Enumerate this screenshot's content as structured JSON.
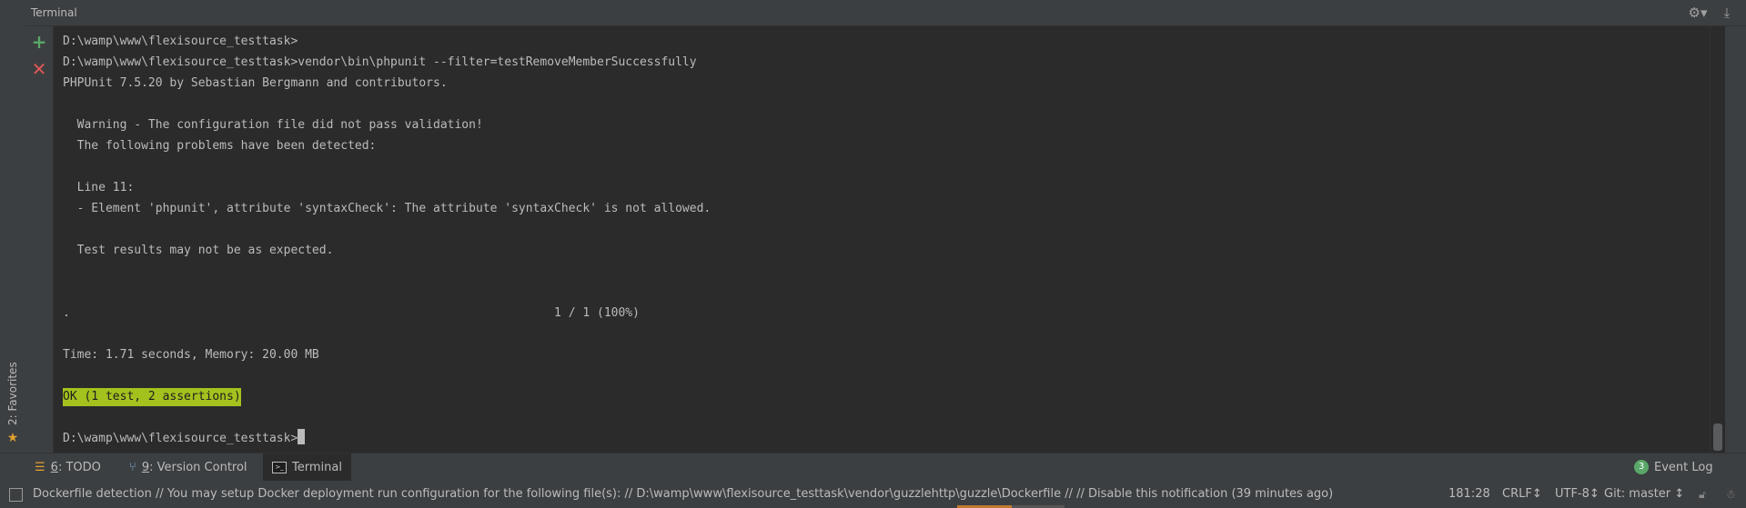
{
  "terminal": {
    "title": "Terminal",
    "lines": [
      "D:\\wamp\\www\\flexisource_testtask>",
      "D:\\wamp\\www\\flexisource_testtask>vendor\\bin\\phpunit --filter=testRemoveMemberSuccessfully",
      "PHPUnit 7.5.20 by Sebastian Bergmann and contributors.",
      "",
      "  Warning - The configuration file did not pass validation!",
      "  The following problems have been detected:",
      "",
      "  Line 11:",
      "  - Element 'phpunit', attribute 'syntaxCheck': The attribute 'syntaxCheck' is not allowed.",
      "",
      "  Test results may not be as expected.",
      "",
      "",
      ".                                                                    1 / 1 (100%)",
      "",
      "Time: 1.71 seconds, Memory: 20.00 MB",
      ""
    ],
    "ok_line": "OK (1 test, 2 assertions)",
    "prompt": "D:\\wamp\\www\\flexisource_testtask>"
  },
  "side_panel": {
    "add_icon": "plus-icon",
    "close_icon": "close-icon"
  },
  "favorites": {
    "label": "2: Favorites",
    "icon": "star-icon"
  },
  "tool_tabs": [
    {
      "mnemonic": "6",
      "label": ": TODO",
      "icon": "todo-icon"
    },
    {
      "mnemonic": "9",
      "label": ": Version Control",
      "icon": "branch-icon"
    },
    {
      "label": "Terminal",
      "icon": "terminal-icon"
    }
  ],
  "event_log": {
    "badge": "3",
    "label": "Event Log"
  },
  "status_bar": {
    "message": "Dockerfile detection  // You may setup Docker deployment run configuration for the following file(s): // D:\\wamp\\www\\flexisource_testtask\\vendor\\guzzlehttp\\guzzle\\Dockerfile // // Disable this notification (39 minutes ago)",
    "position": "181:28",
    "line_separator": "CRLF↕",
    "encoding": "UTF-8↕",
    "git_branch": "Git: master ↕"
  },
  "colors": {
    "ok_background": "#a4c21e",
    "panel_background": "#3c3f41",
    "terminal_background": "#2b2b2b",
    "text": "#bbbbbb"
  }
}
